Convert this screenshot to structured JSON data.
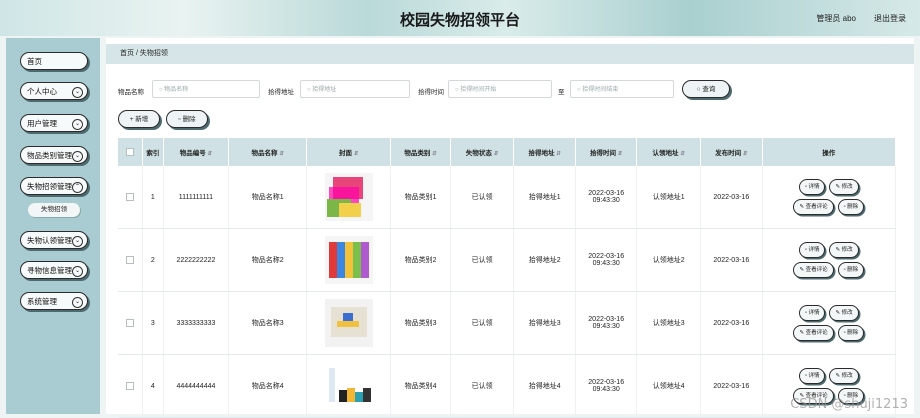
{
  "header": {
    "title": "校园失物招领平台",
    "user": "管理员 abo",
    "logout": "退出登录"
  },
  "sidebar": {
    "items": [
      {
        "label": "首页"
      },
      {
        "label": "个人中心"
      },
      {
        "label": "用户管理"
      },
      {
        "label": "物品类别管理"
      },
      {
        "label": "失物招领管理"
      },
      {
        "label": "失物招领"
      },
      {
        "label": "失物认领管理"
      },
      {
        "label": "寻物信息管理"
      },
      {
        "label": "系统管理"
      }
    ]
  },
  "breadcrumb": {
    "home": "首页",
    "sep": "/",
    "current": "失物招领"
  },
  "search": {
    "name_label": "物品名称",
    "name_placeholder": "物品名称",
    "addr_label": "拾得地址",
    "addr_placeholder": "拾得地址",
    "time_label": "拾得时间",
    "time_start_placeholder": "拾得时间开始",
    "to_label": "至",
    "time_end_placeholder": "拾得时间结束",
    "search_button": "查询"
  },
  "toolbar": {
    "add_button": "+ 新增",
    "delete_button": "删除"
  },
  "table": {
    "headers": [
      "索引",
      "物品编号",
      "物品名称",
      "封面",
      "物品类别",
      "失物状态",
      "拾得地址",
      "拾得时间",
      "认领地址",
      "发布时间",
      "操作"
    ],
    "rows": [
      {
        "index": "1",
        "code": "1111111111",
        "name": "物品名称1",
        "category": "物品类别1",
        "status": "已认领",
        "found_addr": "拾得地址1",
        "found_time": "2022-03-16 09:43:30",
        "claim_addr": "认领地址1",
        "publish": "2022-03-16"
      },
      {
        "index": "2",
        "code": "2222222222",
        "name": "物品名称2",
        "category": "物品类别2",
        "status": "已认领",
        "found_addr": "拾得地址2",
        "found_time": "2022-03-16 09:43:30",
        "claim_addr": "认领地址2",
        "publish": "2022-03-16"
      },
      {
        "index": "3",
        "code": "3333333333",
        "name": "物品名称3",
        "category": "物品类别3",
        "status": "已认领",
        "found_addr": "拾得地址3",
        "found_time": "2022-03-16 09:43:30",
        "claim_addr": "认领地址3",
        "publish": "2022-03-16"
      },
      {
        "index": "4",
        "code": "4444444444",
        "name": "物品名称4",
        "category": "物品类别4",
        "status": "已认领",
        "found_addr": "拾得地址4",
        "found_time": "2022-03-16 09:43:30",
        "claim_addr": "认领地址4",
        "publish": "2022-03-16"
      }
    ],
    "actions": {
      "detail": "详情",
      "edit": "修改",
      "comments": "查看评论",
      "delete": "删除"
    }
  },
  "watermark": "CSDN @shuji1213"
}
